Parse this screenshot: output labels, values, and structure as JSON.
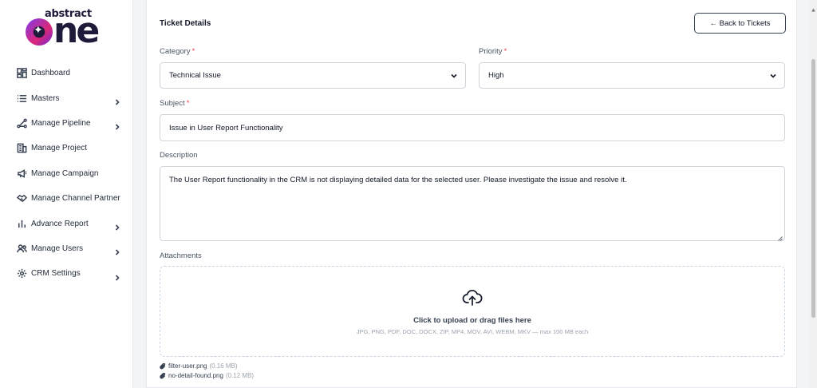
{
  "brand": {
    "top": "abstract",
    "big_rest": "ne"
  },
  "sidebar": {
    "items": [
      {
        "label": "Dashboard",
        "icon": "dashboard-icon",
        "has_children": false
      },
      {
        "label": "Masters",
        "icon": "list-icon",
        "has_children": true
      },
      {
        "label": "Manage Pipeline",
        "icon": "pipeline-icon",
        "has_children": true
      },
      {
        "label": "Manage Project",
        "icon": "building-icon",
        "has_children": false
      },
      {
        "label": "Manage Campaign",
        "icon": "megaphone-icon",
        "has_children": false
      },
      {
        "label": "Manage Channel Partner",
        "icon": "handshake-icon",
        "has_children": false
      },
      {
        "label": "Advance Report",
        "icon": "bar-chart-icon",
        "has_children": true
      },
      {
        "label": "Manage Users",
        "icon": "users-icon",
        "has_children": true
      },
      {
        "label": "CRM Settings",
        "icon": "gear-icon",
        "has_children": true
      }
    ]
  },
  "ticket": {
    "title": "Ticket Details",
    "back_label": "← Back to Tickets",
    "category_label": "Category",
    "category_value": "Technical Issue",
    "priority_label": "Priority",
    "priority_value": "High",
    "required_mark": "*",
    "subject_label": "Subject",
    "subject_value": "Issue in User Report Functionality",
    "description_label": "Description",
    "description_value": "The User Report functionality in the CRM is not displaying detailed data for the selected user. Please investigate the issue and resolve it.",
    "attachments_label": "Attachments",
    "upload_main": "Click to upload or drag files here",
    "upload_sub": "JPG, PNG, PDF, DOC, DOCX, ZIP, MP4, MOV, AVI, WEBM, MKV — max 100 MB each",
    "files": [
      {
        "name": "filter-user.png",
        "size": "(0.16 MB)"
      },
      {
        "name": "no-detail-found.png",
        "size": "(0.12 MB)"
      }
    ]
  },
  "colors": {
    "accent": "#7c3aed",
    "brand_dark": "#1e1b3a",
    "required": "#ef4444"
  }
}
